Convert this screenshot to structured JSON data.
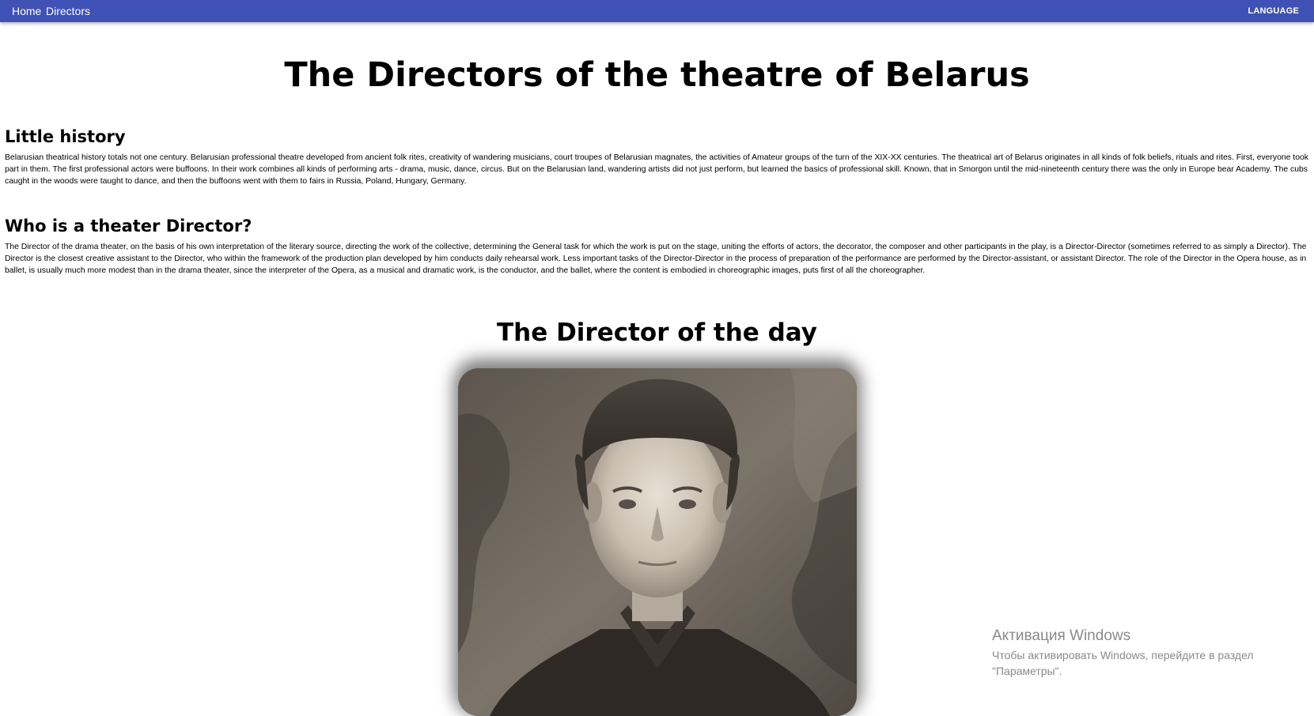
{
  "nav": {
    "home_label": "Home",
    "directors_label": "Directors",
    "language_label": "LANGUAGE"
  },
  "main": {
    "title": "The Directors of the theatre of Belarus",
    "sections": [
      {
        "heading": "Little history",
        "text": "Belarusian theatrical history totals not one century. Belarusian professional theatre developed from ancient folk rites, creativity of wandering musicians, court troupes of Belarusian magnates, the activities of Amateur groups of the turn of the XIX-XX centuries. The theatrical art of Belarus originates in all kinds of folk beliefs, rituals and rites. First, everyone took part in them. The first professional actors were buffoons. In their work combines all kinds of performing arts - drama, music, dance, circus. But on the Belarusian land, wandering artists did not just perform, but learned the basics of professional skill. Known, that in Smorgon until the mid-nineteenth century there was the only in Europe bear Academy. The cubs caught in the woods were taught to dance, and then the buffoons went with them to fairs in Russia, Poland, Hungary, Germany."
      },
      {
        "heading": "Who is a theater Director?",
        "text": "The Director of the drama theater, on the basis of his own interpretation of the literary source, directing the work of the collective, determining the General task for which the work is put on the stage, uniting the efforts of actors, the decorator, the composer and other participants in the play, is a Director-Director (sometimes referred to as simply a Director). The Director is the closest creative assistant to the Director, who within the framework of the production plan developed by him conducts daily rehearsal work. Less important tasks of the Director-Director in the process of preparation of the performance are performed by the Director-assistant, or assistant Director. The role of the Director in the Opera house, as in ballet, is usually much more modest than in the drama theater, since the interpreter of the Opera, as a musical and dramatic work, is the conductor, and the ballet, where the content is embodied in choreographic images, puts first of all the choreographer."
      }
    ],
    "director_of_day_heading": "The Director of the day"
  },
  "watermark": {
    "title": "Активация Windows",
    "text": "Чтобы активировать Windows, перейдите в раздел \"Параметры\"."
  },
  "colors": {
    "navbar": "#3f51b5",
    "nav_text": "#ffffff",
    "page_background": "#ffffff",
    "watermark_text": "#8a8a8a"
  }
}
